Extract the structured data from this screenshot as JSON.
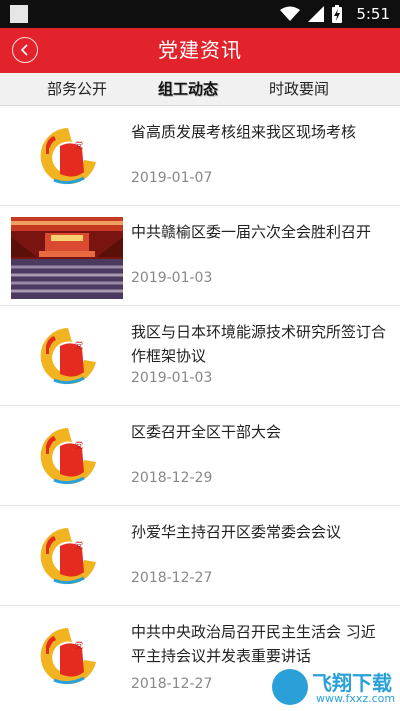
{
  "status_bar": {
    "time": "5:51"
  },
  "header": {
    "title": "党建资讯"
  },
  "tabs": [
    {
      "label": "部务公开",
      "active": false
    },
    {
      "label": "组工动态",
      "active": true
    },
    {
      "label": "时政要闻",
      "active": false
    }
  ],
  "news": [
    {
      "title": "省高质发展考核组来我区现场考核",
      "date": "2019-01-07",
      "thumb": "party-logo"
    },
    {
      "title": "中共赣榆区委一届六次全会胜利召开",
      "date": "2019-01-03",
      "thumb": "meeting-photo"
    },
    {
      "title": "我区与日本环境能源技术研究所签订合作框架协议",
      "date": "2019-01-03",
      "thumb": "party-logo"
    },
    {
      "title": "区委召开全区干部大会",
      "date": "2018-12-29",
      "thumb": "party-logo"
    },
    {
      "title": "孙爱华主持召开区委常委会会议",
      "date": "2018-12-27",
      "thumb": "party-logo"
    },
    {
      "title": "中共中央政治局召开民主生活会 习近平主持会议并发表重要讲话",
      "date": "2018-12-27",
      "thumb": "party-logo"
    }
  ],
  "watermark": {
    "name": "飞翔下载",
    "url": "www.fxxz.com"
  },
  "colors": {
    "header_red": "#e3232b",
    "logo_gold": "#f2b320",
    "date_gray": "#888888"
  }
}
